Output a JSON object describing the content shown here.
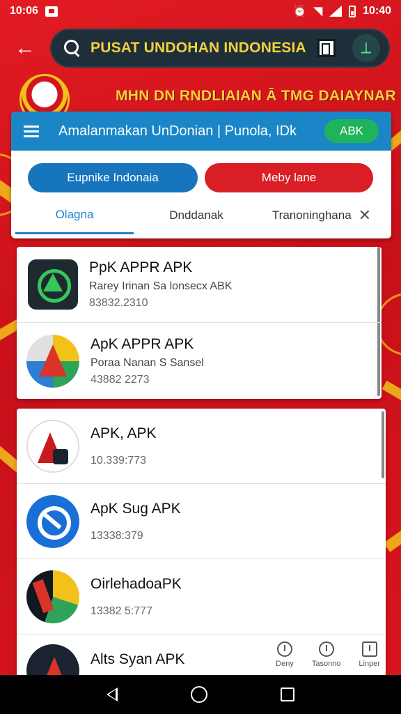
{
  "status": {
    "time_left": "10:06",
    "time_right": "10:40"
  },
  "search": {
    "value": "PUSAT UNDOHAN INDONESIA"
  },
  "banner": {
    "text": "MHN DN RNDLIAIAN Ā TMG DAIAYNAR"
  },
  "header": {
    "title": "Amalanmakan UnDonian | Punola, IDk",
    "badge": "ABK"
  },
  "buttons": {
    "left": "Eupnike Indonaia",
    "right": "Meby lane"
  },
  "tabs": [
    {
      "label": "Olagna"
    },
    {
      "label": "Dnddanak"
    },
    {
      "label": "Tranoninghana"
    }
  ],
  "list_top": [
    {
      "name": "PpK APPR APK",
      "sub": "Rarey Irinan Sa lonsecx ABK",
      "meta": "83832.2310",
      "icon": "green-triangle-icon"
    },
    {
      "name": "ApK APPR APK",
      "sub": "Poraa Nanan S Sansel",
      "meta": "43882 2273",
      "icon": "colorful-a-icon"
    }
  ],
  "list_bottom": [
    {
      "name": "APK, APK",
      "sub": "",
      "meta": "10.339:773",
      "icon": "red-a-icon"
    },
    {
      "name": "ApK Sug APK",
      "sub": "",
      "meta": "13338:379",
      "icon": "blue-circle-icon"
    },
    {
      "name": "OirlehadoaPK",
      "sub": "",
      "meta": "13382 5:777",
      "icon": "multicolor-app-icon"
    },
    {
      "name": "Alts Syan APK",
      "sub": "",
      "meta": "",
      "icon": "dark-a-icon"
    }
  ],
  "mini_nav": [
    {
      "label": "Deny"
    },
    {
      "label": "Tasonno"
    },
    {
      "label": "Linper"
    }
  ],
  "colors": {
    "background_red": "#d4141b",
    "header_blue": "#1a86c7",
    "accent_yellow": "#f2c21a",
    "apk_green": "#1fb35b",
    "search_bg": "#1e2f3a"
  }
}
